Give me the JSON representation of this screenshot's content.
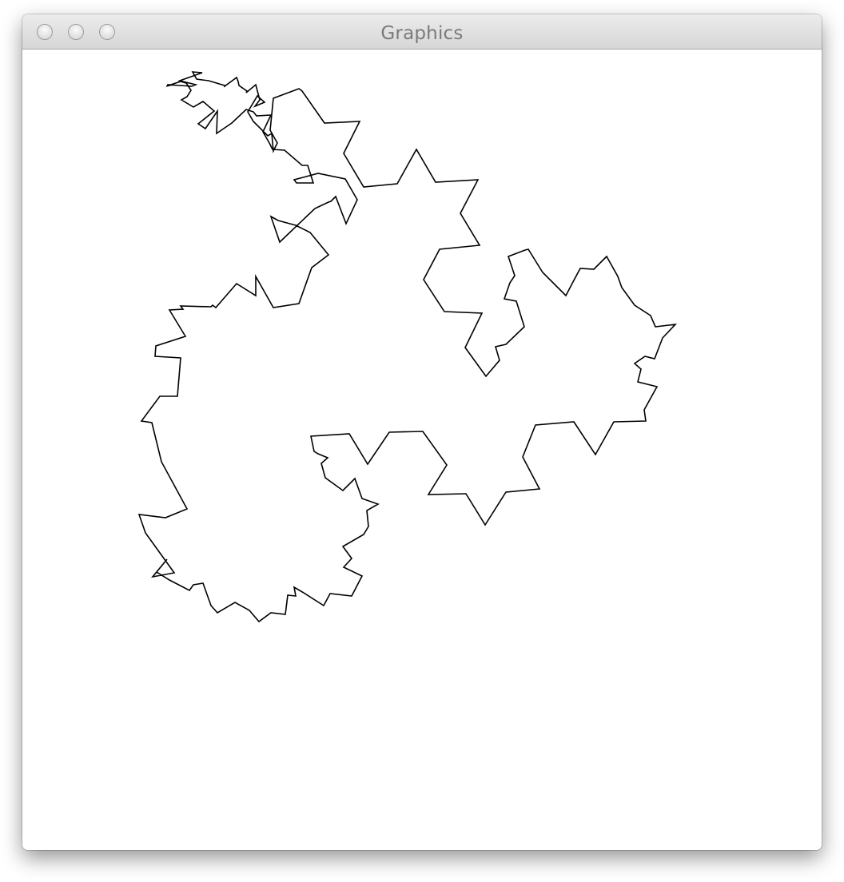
{
  "window": {
    "title": "Graphics"
  },
  "controls": {
    "close_icon": "close-circle-icon",
    "minimize_icon": "minimize-circle-icon",
    "zoom_icon": "zoom-circle-icon"
  },
  "drawing": {
    "shape": "koch-style fractal outline",
    "stroke_color": "#000000",
    "background_color": "#ffffff"
  }
}
